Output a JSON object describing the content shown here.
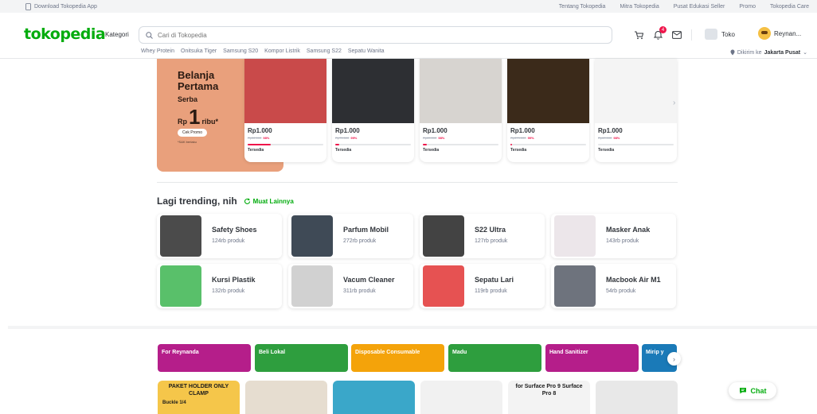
{
  "topbar": {
    "app_link": "Download Tokopedia App",
    "links": [
      "Tentang Tokopedia",
      "Mitra Tokopedia",
      "Pusat Edukasi Seller",
      "Promo",
      "Tokopedia Care"
    ]
  },
  "header": {
    "logo": "tokopedia",
    "kategori": "Kategori",
    "search_placeholder": "Cari di Tokopedia",
    "notification_count": "4",
    "toko_label": "Toko",
    "user_name": "Reynan...",
    "quick_links": [
      "Whey Protein",
      "Onitsuka Tiger",
      "Samsung S20",
      "Kompor Listrik",
      "Samsung S22",
      "Sepatu Wanita"
    ],
    "delivery_prefix": "Dikirim ke",
    "delivery_location": "Jakarta Pusat"
  },
  "promo": {
    "title": "Belanja Pertama",
    "subtitle": "Serba",
    "currency": "Rp",
    "amount": "1",
    "unit": "ribu*",
    "cta": "Cek Promo",
    "note": "*S&K berlaku"
  },
  "products": [
    {
      "price": "Rp1.000",
      "original": "Rp52.000",
      "discount": "98%",
      "stock": "Tersedia",
      "sold": 0.3,
      "color": "#c94a4a"
    },
    {
      "price": "Rp1.000",
      "original": "Rp75.500",
      "discount": "99%",
      "stock": "Tersedia",
      "sold": 0.05,
      "color": "#2d2f33"
    },
    {
      "price": "Rp1.000",
      "original": "Rp65.000",
      "discount": "98%",
      "stock": "Tersedia",
      "sold": 0.05,
      "color": "#d7d4d0"
    },
    {
      "price": "Rp1.000",
      "original": "Rp379.000",
      "discount": "99%",
      "stock": "Tersedia",
      "sold": 0.02,
      "color": "#3b2a1a"
    },
    {
      "price": "Rp1.000",
      "original": "Rp60.000",
      "discount": "98%",
      "stock": "Tersedia",
      "sold": 0.0,
      "color": "#f4f4f4"
    }
  ],
  "trending": {
    "title": "Lagi trending, nih",
    "more": "Muat Lainnya",
    "items": [
      {
        "name": "Safety Shoes",
        "count": "124rb produk",
        "color": "#2b2b2b"
      },
      {
        "name": "Parfum Mobil",
        "count": "272rb produk",
        "color": "#1d2a38"
      },
      {
        "name": "S22 Ultra",
        "count": "127rb produk",
        "color": "#222"
      },
      {
        "name": "Masker Anak",
        "count": "143rb produk",
        "color": "#e9e2e6"
      },
      {
        "name": "Kursi Plastik",
        "count": "132rb produk",
        "color": "#3cb550"
      },
      {
        "name": "Vacum Cleaner",
        "count": "311rb produk",
        "color": "#c9c9c9"
      },
      {
        "name": "Sepatu Lari",
        "count": "119rb produk",
        "color": "#e23434"
      },
      {
        "name": "Macbook Air M1",
        "count": "54rb produk",
        "color": "#555b66"
      }
    ]
  },
  "categories": [
    {
      "label": "For Reynanda",
      "color": "#b51e8a"
    },
    {
      "label": "Beli Lokal",
      "color": "#2e9e3e"
    },
    {
      "label": "Disposable Consumable",
      "color": "#f4a30a"
    },
    {
      "label": "Madu",
      "color": "#2e9e3e"
    },
    {
      "label": "Hand Sanitizer",
      "color": "#b51e8a"
    },
    {
      "label": "Mirip y",
      "color": "#1a7ab8"
    }
  ],
  "bottom_cards": [
    {
      "text": "PAKET HOLDER ONLY CLAMP",
      "sub": "Buckle 1/4",
      "color": "#f5c64a"
    },
    {
      "text": "",
      "sub": "",
      "color": "#e6ddd0"
    },
    {
      "text": "",
      "sub": "",
      "color": "#3aa7c9"
    },
    {
      "text": "",
      "sub": "",
      "color": "#f1f1f1"
    },
    {
      "text": "for Surface Pro 9 Surface Pro 8",
      "sub": "",
      "color": "#f3f3f3"
    },
    {
      "text": "",
      "sub": "",
      "color": "#e8e8e8"
    }
  ],
  "chat": "Chat",
  "colors": {
    "brand": "#03ac0e",
    "alert": "#ef144a"
  }
}
